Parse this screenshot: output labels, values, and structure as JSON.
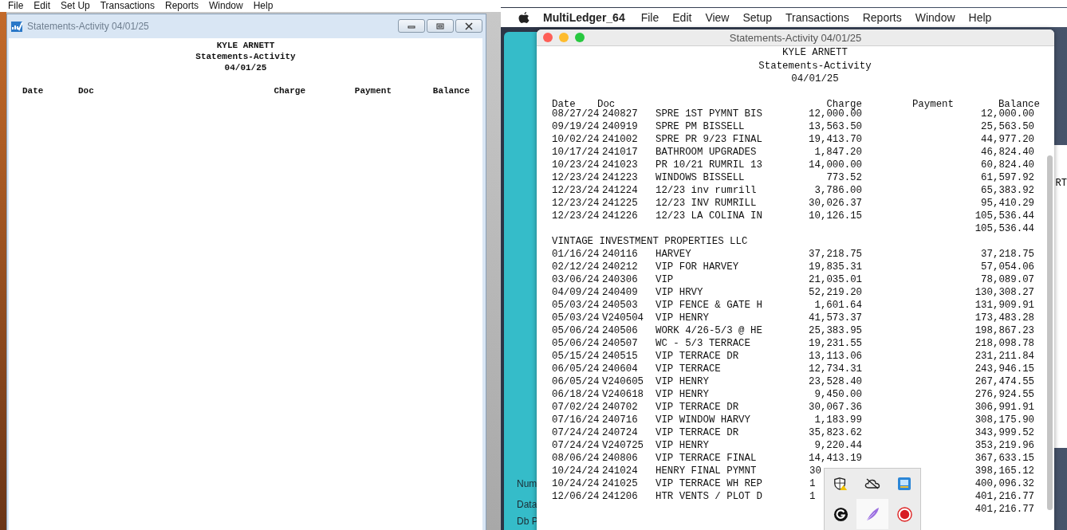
{
  "windows_app": {
    "menu": [
      "File",
      "Edit",
      "Set Up",
      "Transactions",
      "Reports",
      "Window",
      "Help"
    ],
    "window": {
      "title": "Statements-Activity 04/01/25",
      "report": {
        "company": "KYLE ARNETT",
        "title": "Statements-Activity",
        "date": "04/01/25",
        "columns": [
          "Date",
          "Doc",
          "Charge",
          "Payment",
          "Balance"
        ]
      }
    }
  },
  "mac_app": {
    "app_name": "MultiLedger_64",
    "menu": [
      "File",
      "Edit",
      "View",
      "Setup",
      "Transactions",
      "Reports",
      "Window",
      "Help"
    ],
    "background_labels": [
      "Num",
      "Data",
      "Db P"
    ],
    "side_text": "RT",
    "window": {
      "title": "Statements-Activity 04/01/25",
      "report": {
        "company": "KYLE ARNETT",
        "title": "Statements-Activity",
        "date": "04/01/25",
        "columns": [
          "Date",
          "Doc",
          "Charge",
          "Payment",
          "Balance"
        ],
        "sections": [
          {
            "rows": [
              {
                "date": "08/27/24",
                "doc": "240827",
                "description": "SPRE 1ST PYMNT BIS",
                "charge": "12,000.00",
                "balance": "12,000.00"
              },
              {
                "date": "09/19/24",
                "doc": "240919",
                "description": "SPRE PM BISSELL",
                "charge": "13,563.50",
                "balance": "25,563.50"
              },
              {
                "date": "10/02/24",
                "doc": "241002",
                "description": "SPRE PR 9/23 FINAL",
                "charge": "19,413.70",
                "balance": "44,977.20"
              },
              {
                "date": "10/17/24",
                "doc": "241017",
                "description": "BATHROOM UPGRADES",
                "charge": "1,847.20",
                "balance": "46,824.40"
              },
              {
                "date": "10/23/24",
                "doc": "241023",
                "description": "PR 10/21 RUMRIL 13",
                "charge": "14,000.00",
                "balance": "60,824.40"
              },
              {
                "date": "12/23/24",
                "doc": "241223",
                "description": "WINDOWS BISSELL",
                "charge": "773.52",
                "balance": "61,597.92"
              },
              {
                "date": "12/23/24",
                "doc": "241224",
                "description": "12/23 inv rumrill",
                "charge": "3,786.00",
                "balance": "65,383.92"
              },
              {
                "date": "12/23/24",
                "doc": "241225",
                "description": "12/23 INV RUMRILL",
                "charge": "30,026.37",
                "balance": "95,410.29"
              },
              {
                "date": "12/23/24",
                "doc": "241226",
                "description": "12/23 LA COLINA IN",
                "charge": "10,126.15",
                "balance": "105,536.44"
              }
            ],
            "total": "105,536.44"
          },
          {
            "heading": "VINTAGE INVESTMENT PROPERTIES LLC",
            "rows": [
              {
                "date": "01/16/24",
                "doc": "240116",
                "description": "HARVEY",
                "charge": "37,218.75",
                "balance": "37,218.75"
              },
              {
                "date": "02/12/24",
                "doc": "240212",
                "description": "VIP FOR HARVEY",
                "charge": "19,835.31",
                "balance": "57,054.06"
              },
              {
                "date": "03/06/24",
                "doc": "240306",
                "description": "VIP",
                "charge": "21,035.01",
                "balance": "78,089.07"
              },
              {
                "date": "04/09/24",
                "doc": "240409",
                "description": "VIP HRVY",
                "charge": "52,219.20",
                "balance": "130,308.27"
              },
              {
                "date": "05/03/24",
                "doc": "240503",
                "description": "VIP FENCE & GATE H",
                "charge": "1,601.64",
                "balance": "131,909.91"
              },
              {
                "date": "05/03/24",
                "doc": "V240504",
                "description": "VIP HENRY",
                "charge": "41,573.37",
                "balance": "173,483.28"
              },
              {
                "date": "05/06/24",
                "doc": "240506",
                "description": "WORK 4/26-5/3 @ HE",
                "charge": "25,383.95",
                "balance": "198,867.23"
              },
              {
                "date": "05/06/24",
                "doc": "240507",
                "description": "WC - 5/3 TERRACE",
                "charge": "19,231.55",
                "balance": "218,098.78"
              },
              {
                "date": "05/15/24",
                "doc": "240515",
                "description": "VIP TERRACE DR",
                "charge": "13,113.06",
                "balance": "231,211.84"
              },
              {
                "date": "06/05/24",
                "doc": "240604",
                "description": "VIP TERRACE",
                "charge": "12,734.31",
                "balance": "243,946.15"
              },
              {
                "date": "06/05/24",
                "doc": "V240605",
                "description": "VIP HENRY",
                "charge": "23,528.40",
                "balance": "267,474.55"
              },
              {
                "date": "06/18/24",
                "doc": "V240618",
                "description": "VIP HENRY",
                "charge": "9,450.00",
                "balance": "276,924.55"
              },
              {
                "date": "07/02/24",
                "doc": "240702",
                "description": "VIP TERRACE DR",
                "charge": "30,067.36",
                "balance": "306,991.91"
              },
              {
                "date": "07/16/24",
                "doc": "240716",
                "description": "VIP WINDOW HARVY",
                "charge": "1,183.99",
                "balance": "308,175.90"
              },
              {
                "date": "07/24/24",
                "doc": "240724",
                "description": "VIP TERRACE DR",
                "charge": "35,823.62",
                "balance": "343,999.52"
              },
              {
                "date": "07/24/24",
                "doc": "V240725",
                "description": "VIP HENRY",
                "charge": "9,220.44",
                "balance": "353,219.96"
              },
              {
                "date": "08/06/24",
                "doc": "240806",
                "description": "VIP TERRACE FINAL",
                "charge": "14,413.19",
                "balance": "367,633.15"
              },
              {
                "date": "10/24/24",
                "doc": "241024",
                "description": "HENRY FINAL PYMNT",
                "charge": "30",
                "charge_cut": true,
                "balance": "398,165.12"
              },
              {
                "date": "10/24/24",
                "doc": "241025",
                "description": "VIP TERRACE WH REP",
                "charge": "1",
                "charge_cut": true,
                "balance": "400,096.32"
              },
              {
                "date": "12/06/24",
                "doc": "241206",
                "description": "HTR VENTS / PLOT D",
                "charge": "1",
                "charge_cut": true,
                "balance": "401,216.77"
              }
            ],
            "total": "401,216.77"
          }
        ]
      }
    }
  },
  "tray_popup": {
    "icons": [
      {
        "kind": "shield",
        "selected": false
      },
      {
        "kind": "cloud",
        "selected": false
      },
      {
        "kind": "app",
        "selected": false
      },
      {
        "kind": "grammar",
        "selected": false
      },
      {
        "kind": "feather",
        "selected": true
      },
      {
        "kind": "record",
        "selected": false
      }
    ]
  }
}
